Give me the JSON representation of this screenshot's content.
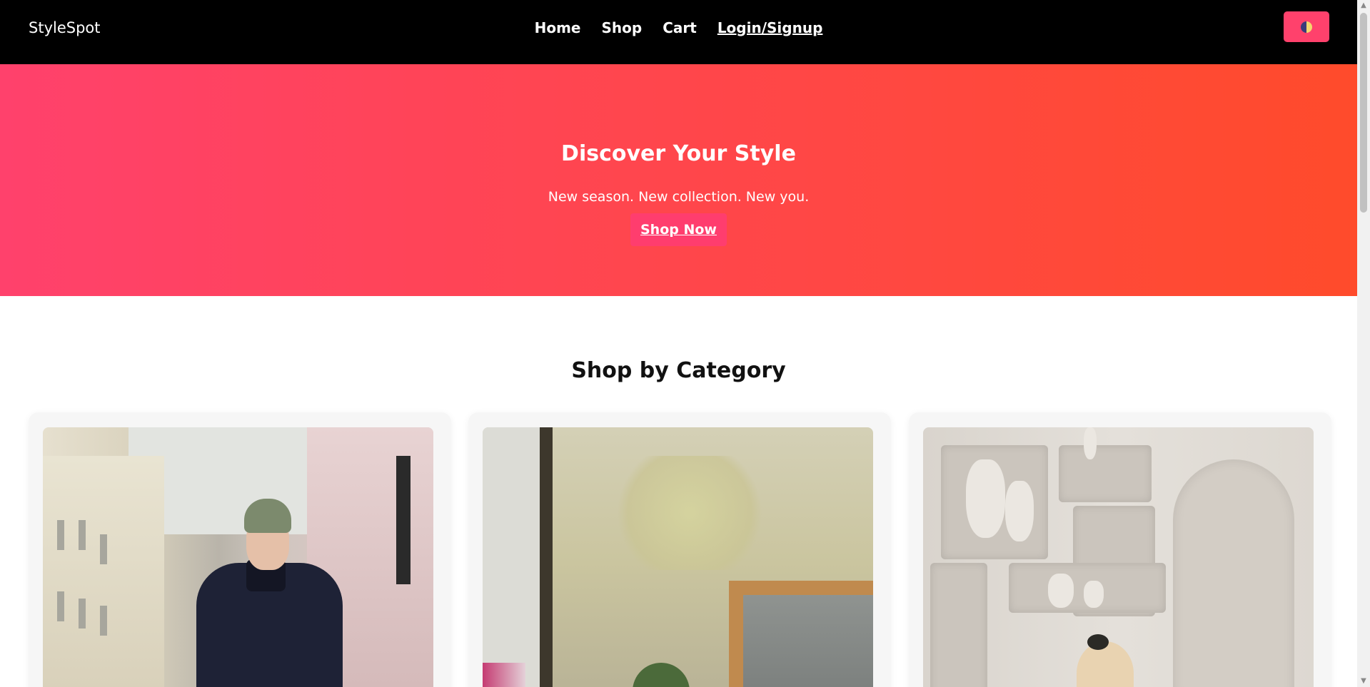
{
  "navbar": {
    "brand": "StyleSpot",
    "links": [
      {
        "label": "Home"
      },
      {
        "label": "Shop"
      },
      {
        "label": "Cart"
      },
      {
        "label": "Login/Signup"
      }
    ],
    "theme_toggle_icon": "half-moon-icon"
  },
  "hero": {
    "title": "Discover Your Style",
    "subtitle": "New season. New collection. New you.",
    "cta_label": "Shop Now"
  },
  "categories": {
    "title": "Shop by Category"
  },
  "colors": {
    "navbar_bg": "#000000",
    "accent": "#ff416c",
    "hero_gradient_start": "#ff416c",
    "hero_gradient_end": "#ff4b2b"
  },
  "scrollbar": {
    "up_icon": "▲",
    "down_icon": "▼"
  }
}
